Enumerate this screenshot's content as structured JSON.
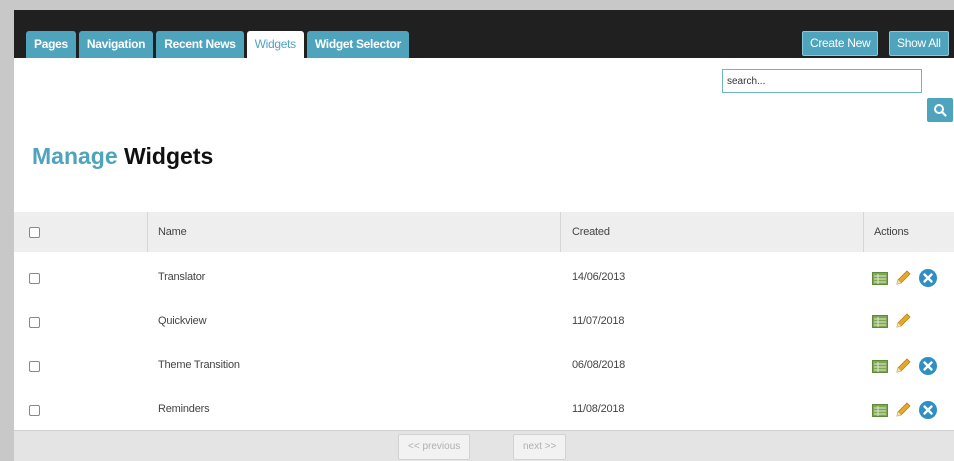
{
  "tabs": [
    {
      "label": "Pages",
      "active": false
    },
    {
      "label": "Navigation",
      "active": false
    },
    {
      "label": "Recent News",
      "active": false
    },
    {
      "label": "Widgets",
      "active": true
    },
    {
      "label": "Widget Selector",
      "active": false
    }
  ],
  "toolbar": {
    "create_new_label": "Create New",
    "show_all_label": "Show All"
  },
  "search": {
    "value": "search..."
  },
  "page_title": {
    "accent": "Manage",
    "main": "Widgets"
  },
  "table": {
    "headers": {
      "name": "Name",
      "created": "Created",
      "actions": "Actions"
    },
    "rows": [
      {
        "name": "Translator",
        "created": "14/06/2013",
        "deletable": true
      },
      {
        "name": "Quickview",
        "created": "11/07/2018",
        "deletable": false
      },
      {
        "name": "Theme Transition",
        "created": "06/08/2018",
        "deletable": true
      },
      {
        "name": "Reminders",
        "created": "11/08/2018",
        "deletable": true
      }
    ]
  },
  "pager": {
    "previous_label": "<< previous",
    "next_label": "next >>"
  },
  "colors": {
    "accent": "#4fa4bd",
    "topbar": "#202020",
    "delete": "#2f8fc4",
    "edit": "#e3a92a",
    "view": "#7fa652"
  }
}
